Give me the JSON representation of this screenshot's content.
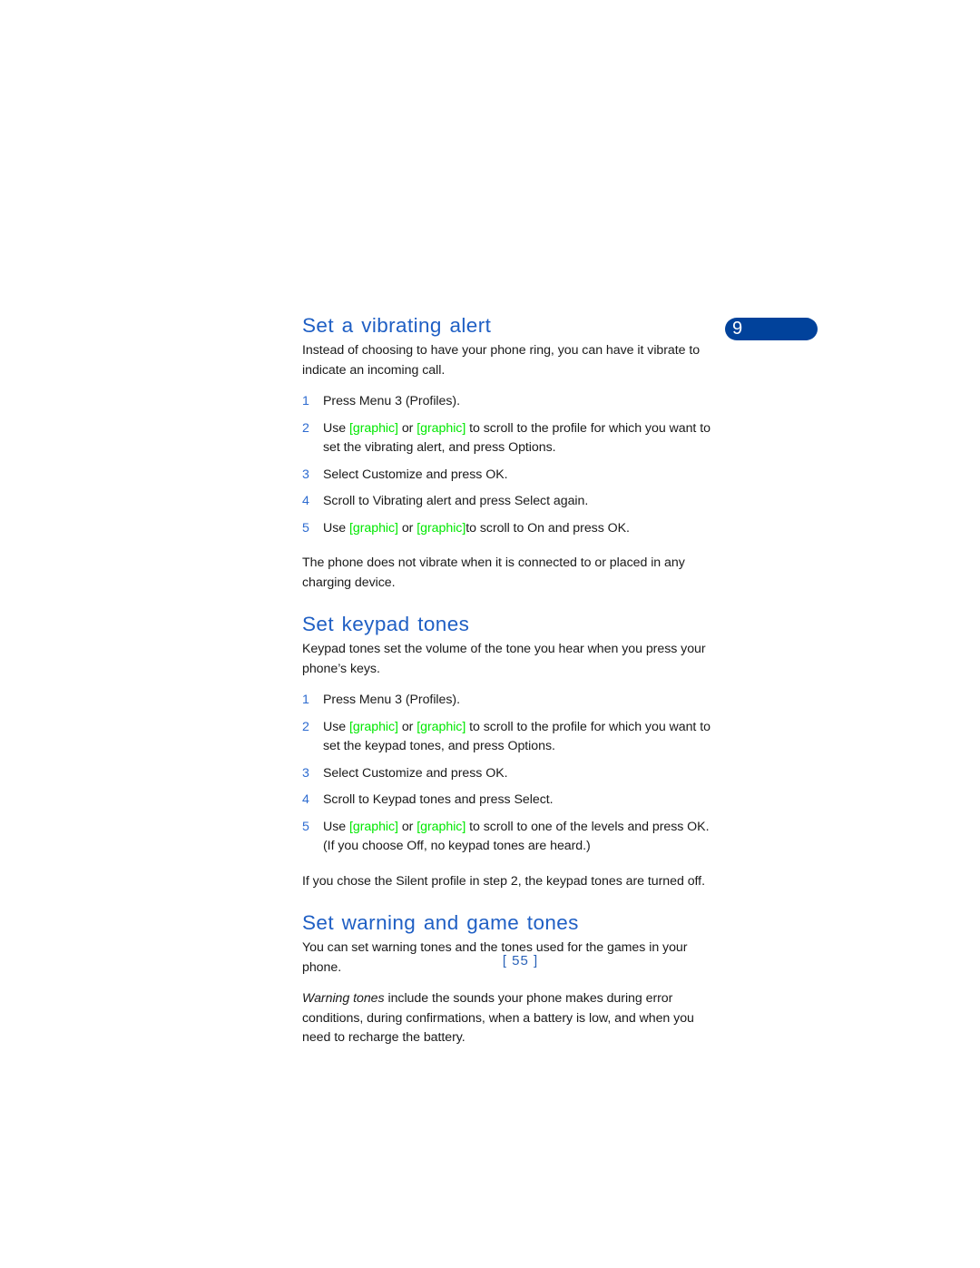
{
  "page": {
    "number_label": "[ 55 ]",
    "chapter_tab_number": "9",
    "colors": {
      "heading_blue": "#1f5fc4",
      "step_number_blue": "#2d6bd0",
      "tab_navy": "#01429b",
      "graphic_token_green": "#00e800",
      "body_text": "#1a1a1a",
      "page_number_blue": "#2a62b8",
      "background": "#ffffff"
    }
  },
  "sections": [
    {
      "heading": "Set a vibrating alert",
      "intro": "Instead of choosing to have your phone ring, you can have it vibrate to indicate an incoming call.",
      "steps": [
        {
          "num": "1",
          "parts": [
            {
              "type": "text",
              "text": "Press Menu 3 (Profiles)."
            }
          ]
        },
        {
          "num": "2",
          "parts": [
            {
              "type": "text",
              "text": "Use "
            },
            {
              "type": "graphic",
              "text": "[graphic]"
            },
            {
              "type": "text",
              "text": " or "
            },
            {
              "type": "graphic",
              "text": "[graphic]"
            },
            {
              "type": "text",
              "text": " to scroll to the profile for which you want to set the vibrating alert, and press Options."
            }
          ]
        },
        {
          "num": "3",
          "parts": [
            {
              "type": "text",
              "text": "Select Customize and press OK."
            }
          ]
        },
        {
          "num": "4",
          "parts": [
            {
              "type": "text",
              "text": "Scroll to Vibrating alert and press Select again."
            }
          ]
        },
        {
          "num": "5",
          "parts": [
            {
              "type": "text",
              "text": "Use "
            },
            {
              "type": "graphic",
              "text": "[graphic]"
            },
            {
              "type": "text",
              "text": " or "
            },
            {
              "type": "graphic",
              "text": "[graphic]"
            },
            {
              "type": "text",
              "text": "to scroll to On and press OK."
            }
          ]
        }
      ],
      "notes": [
        "The phone does not vibrate when it is connected to or placed in any charging device."
      ]
    },
    {
      "heading": "Set keypad tones",
      "intro": "Keypad tones set the volume of the tone you hear when you press your phone’s keys.",
      "steps": [
        {
          "num": "1",
          "parts": [
            {
              "type": "text",
              "text": "Press Menu 3 (Profiles)."
            }
          ]
        },
        {
          "num": "2",
          "parts": [
            {
              "type": "text",
              "text": "Use "
            },
            {
              "type": "graphic",
              "text": "[graphic]"
            },
            {
              "type": "text",
              "text": " or "
            },
            {
              "type": "graphic",
              "text": "[graphic]"
            },
            {
              "type": "text",
              "text": " to scroll to the profile for which you want to set the keypad tones, and press Options."
            }
          ]
        },
        {
          "num": "3",
          "parts": [
            {
              "type": "text",
              "text": "Select Customize and press OK."
            }
          ]
        },
        {
          "num": "4",
          "parts": [
            {
              "type": "text",
              "text": "Scroll to Keypad tones and press Select."
            }
          ]
        },
        {
          "num": "5",
          "parts": [
            {
              "type": "text",
              "text": "Use "
            },
            {
              "type": "graphic",
              "text": "[graphic]"
            },
            {
              "type": "text",
              "text": " or "
            },
            {
              "type": "graphic",
              "text": "[graphic]"
            },
            {
              "type": "text",
              "text": " to scroll to one of the levels and press OK. (If you choose Off, no keypad tones are heard.)"
            }
          ]
        }
      ],
      "notes": [
        "If you chose the Silent profile in step 2, the keypad tones are turned off."
      ]
    },
    {
      "heading": "Set warning and game tones",
      "intro": "You can set warning tones and the tones used for the games in your phone.",
      "steps": [],
      "notes": [],
      "rich_paragraph": {
        "italic_lead": "Warning tones",
        "rest": " include the sounds your phone makes during error conditions, during confirmations, when a battery is low, and when you need to recharge the battery."
      }
    }
  ]
}
